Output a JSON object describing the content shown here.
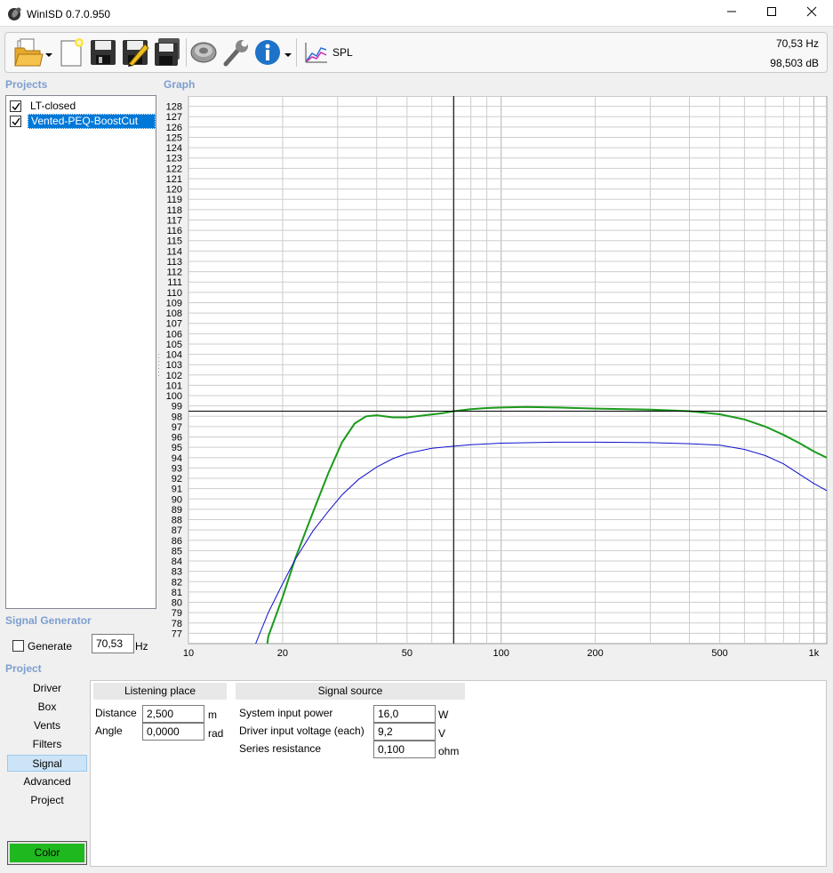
{
  "window": {
    "title": "WinISD 0.7.0.950"
  },
  "toolbar": {
    "spl_label": "SPL",
    "readout_frequency": "70,53 Hz",
    "readout_level": "98,503 dB"
  },
  "projects": {
    "heading": "Projects",
    "items": [
      {
        "label": "LT-closed",
        "checked": true,
        "selected": false
      },
      {
        "label": "Vented-PEQ-BoostCut",
        "checked": true,
        "selected": true
      }
    ]
  },
  "graph": {
    "heading": "Graph",
    "cursor": {
      "frequency_hz": 70.53,
      "level_db": 98.503
    }
  },
  "chart_data": {
    "type": "line",
    "x_scale": "log",
    "xlim": [
      10,
      1100
    ],
    "ylim": [
      76,
      129
    ],
    "x_ticks": [
      {
        "v": 10,
        "label": "10"
      },
      {
        "v": 20,
        "label": "20"
      },
      {
        "v": 50,
        "label": "50"
      },
      {
        "v": 100,
        "label": "100"
      },
      {
        "v": 200,
        "label": "200"
      },
      {
        "v": 500,
        "label": "500"
      },
      {
        "v": 1000,
        "label": "1k"
      }
    ],
    "y_tick_range": [
      77,
      128
    ],
    "grid": true,
    "series": [
      {
        "color": "#1a9a1a",
        "points": [
          [
            17.5,
            74
          ],
          [
            18,
            76.7
          ],
          [
            20,
            80.5
          ],
          [
            22,
            84.3
          ],
          [
            25,
            88.7
          ],
          [
            28,
            92.5
          ],
          [
            31,
            95.5
          ],
          [
            34,
            97.3
          ],
          [
            37,
            98
          ],
          [
            40,
            98.1
          ],
          [
            45,
            97.9
          ],
          [
            50,
            97.9
          ],
          [
            57,
            98.1
          ],
          [
            65,
            98.3
          ],
          [
            70.53,
            98.5
          ],
          [
            80,
            98.7
          ],
          [
            90,
            98.8
          ],
          [
            100,
            98.85
          ],
          [
            120,
            98.9
          ],
          [
            150,
            98.85
          ],
          [
            200,
            98.75
          ],
          [
            300,
            98.65
          ],
          [
            400,
            98.5
          ],
          [
            500,
            98.2
          ],
          [
            600,
            97.7
          ],
          [
            700,
            97
          ],
          [
            800,
            96.2
          ],
          [
            900,
            95.4
          ],
          [
            1000,
            94.6
          ],
          [
            1100,
            94
          ]
        ]
      },
      {
        "color": "#1010cc",
        "points": [
          [
            15.5,
            74
          ],
          [
            16,
            75.2
          ],
          [
            18,
            79
          ],
          [
            20,
            81.8
          ],
          [
            22,
            84.2
          ],
          [
            25,
            86.9
          ],
          [
            28,
            88.8
          ],
          [
            31,
            90.4
          ],
          [
            35,
            91.9
          ],
          [
            40,
            93.1
          ],
          [
            45,
            93.9
          ],
          [
            50,
            94.4
          ],
          [
            60,
            94.9
          ],
          [
            70,
            95.1
          ],
          [
            80,
            95.25
          ],
          [
            100,
            95.4
          ],
          [
            150,
            95.5
          ],
          [
            200,
            95.5
          ],
          [
            300,
            95.45
          ],
          [
            400,
            95.35
          ],
          [
            500,
            95.2
          ],
          [
            600,
            94.8
          ],
          [
            700,
            94.2
          ],
          [
            800,
            93.4
          ],
          [
            900,
            92.4
          ],
          [
            1000,
            91.5
          ],
          [
            1100,
            90.8
          ]
        ]
      }
    ]
  },
  "signal_generator": {
    "heading": "Signal Generator",
    "generate_label": "Generate",
    "frequency_value": "70,53",
    "unit": "Hz"
  },
  "project_section": {
    "heading": "Project",
    "nav": [
      {
        "label": "Driver",
        "selected": false
      },
      {
        "label": "Box",
        "selected": false
      },
      {
        "label": "Vents",
        "selected": false
      },
      {
        "label": "Filters",
        "selected": false
      },
      {
        "label": "Signal",
        "selected": true
      },
      {
        "label": "Advanced",
        "selected": false
      },
      {
        "label": "Project",
        "selected": false
      }
    ],
    "color_button": "Color",
    "color_value": "#1fb81f"
  },
  "listening_place": {
    "header": "Listening place",
    "distance_label": "Distance",
    "distance_value": "2,500",
    "distance_unit": "m",
    "angle_label": "Angle",
    "angle_value": "0,0000",
    "angle_unit": "rad"
  },
  "signal_source": {
    "header": "Signal source",
    "power_label": "System input power",
    "power_value": "16,0",
    "power_unit": "W",
    "voltage_label": "Driver input voltage (each)",
    "voltage_value": "9,2",
    "voltage_unit": "V",
    "resistance_label": "Series resistance",
    "resistance_value": "0,100",
    "resistance_unit": "ohm"
  }
}
